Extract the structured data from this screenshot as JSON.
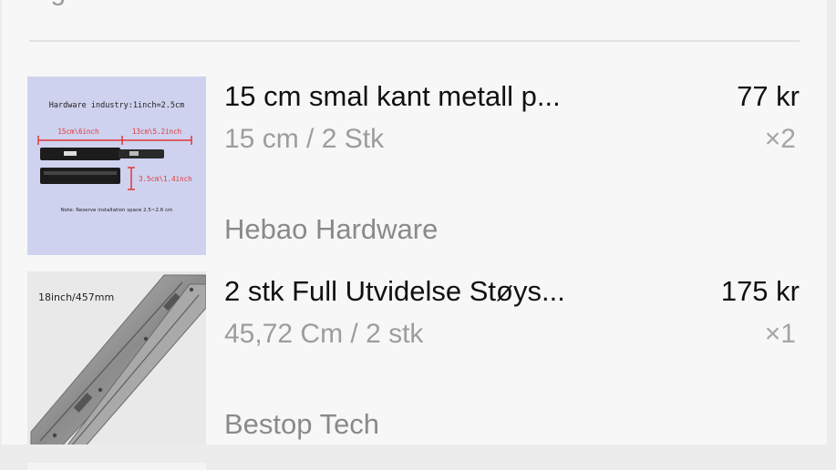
{
  "header": {
    "partial_text": "..ig"
  },
  "items": [
    {
      "title": "15 cm smal kant metall p...",
      "variant": "15 cm / 2 Stk",
      "price": "77 kr",
      "quantity": "×2",
      "seller": "Hebao Hardware",
      "image": {
        "heading": "Hardware industry:1inch=2.5cm",
        "dim_a": "15cm\\6inch",
        "dim_b": "13cm\\5.2inch",
        "dim_c": "3.5cm\\1.4inch",
        "note": "Note: Reserve installation space 2.5~2.6 cm",
        "background": "#cfd2ef"
      }
    },
    {
      "title": "2 stk Full Utvidelse Støys...",
      "variant": "45,72 Cm / 2 stk",
      "price": "175 kr",
      "quantity": "×1",
      "seller": "Bestop Tech",
      "image": {
        "label": "18inch/457mm",
        "background": "#e9e9e9"
      }
    }
  ],
  "colors": {
    "title": "#111111",
    "secondary": "#9d9d9d",
    "seller": "#8a8a8a",
    "dimension_red": "#e0383a"
  }
}
